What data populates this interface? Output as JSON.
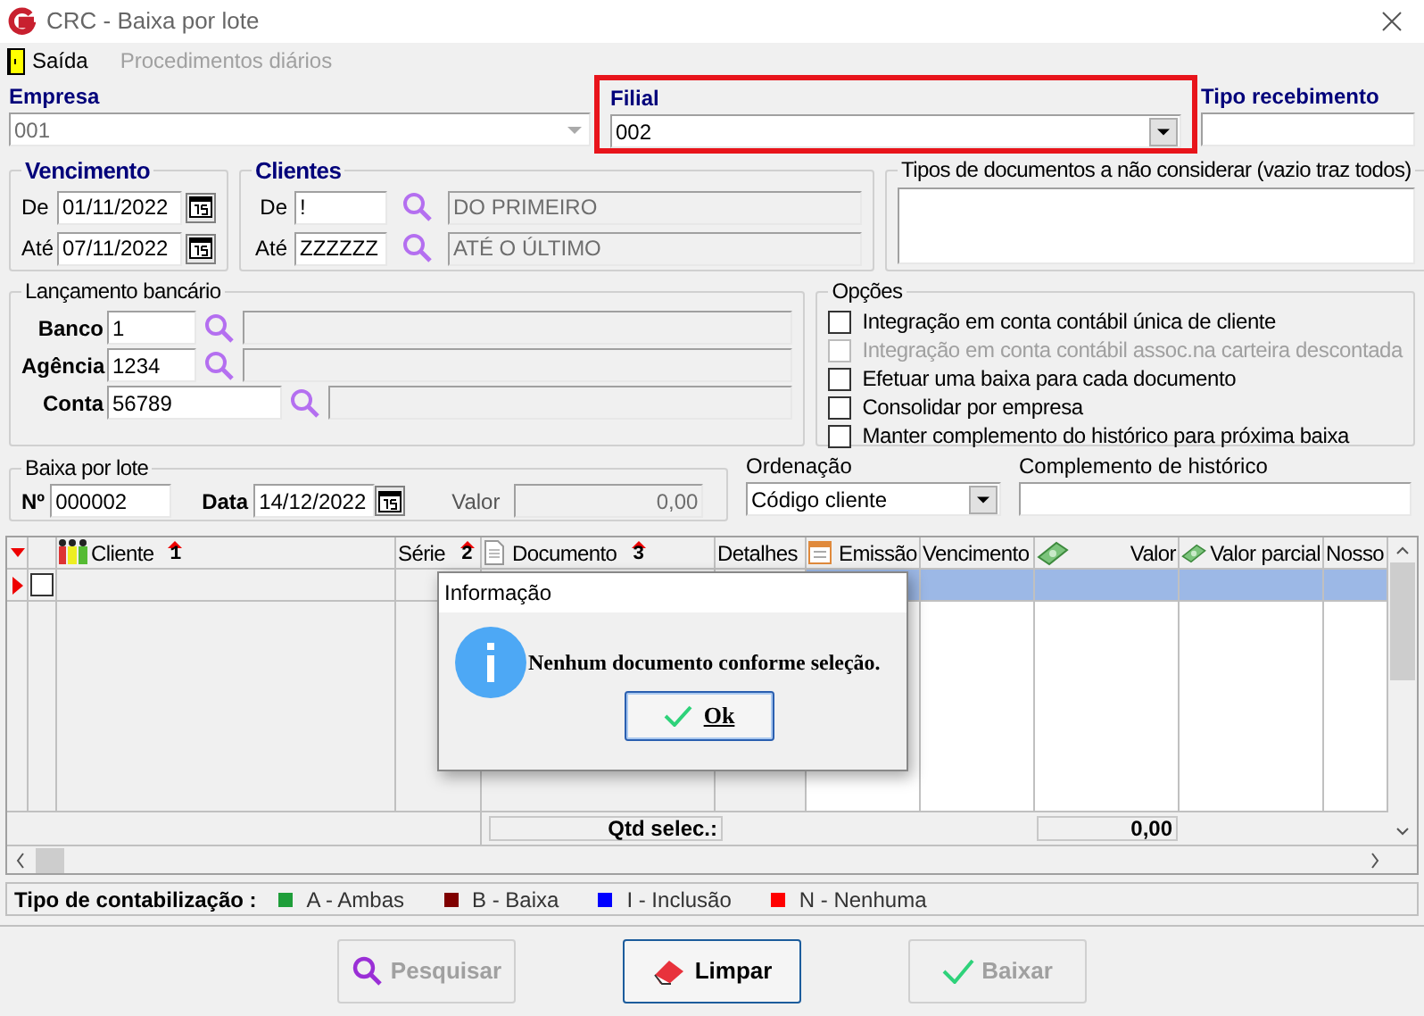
{
  "window": {
    "title": "CRC - Baixa por lote"
  },
  "menu": [
    {
      "label": "Saída",
      "disabled": false
    },
    {
      "label": "Procedimentos diários",
      "disabled": true
    }
  ],
  "empresa": {
    "label": "Empresa",
    "value": "001"
  },
  "filial": {
    "label": "Filial",
    "value": "002",
    "highlighted": true
  },
  "tipo_recebimento": {
    "label": "Tipo recebimento"
  },
  "vencimento": {
    "title": "Vencimento",
    "from_label": "De",
    "from": "01/11/2022",
    "to_label": "Até",
    "to": "07/11/2022"
  },
  "clientes": {
    "title": "Clientes",
    "from_label": "De",
    "from": "!",
    "from_name": "DO PRIMEIRO",
    "to_label": "Até",
    "to": "ZZZZZZ",
    "to_name": "ATÉ O ÚLTIMO"
  },
  "tipos_documentos": {
    "title": "Tipos de documentos a não considerar (vazio traz todos)"
  },
  "lancamento": {
    "title": "Lançamento bancário",
    "fields": [
      {
        "label": "Banco",
        "value": "1"
      },
      {
        "label": "Agência",
        "value": "1234"
      },
      {
        "label": "Conta",
        "value": "56789"
      }
    ]
  },
  "opcoes": {
    "title": "Opções",
    "items": [
      {
        "label": "Integração em conta contábil única de cliente",
        "checked": false,
        "disabled": false
      },
      {
        "label": "Integração em conta contábil assoc.na carteira descontada",
        "checked": false,
        "disabled": true
      },
      {
        "label": "Efetuar uma baixa para cada documento",
        "checked": false,
        "disabled": false
      },
      {
        "label": "Consolidar por empresa",
        "checked": false,
        "disabled": false
      },
      {
        "label": "Manter complemento do histórico para próxima baixa",
        "checked": false,
        "disabled": false
      }
    ]
  },
  "baixa": {
    "title": "Baixa por lote",
    "numero_label": "Nº",
    "numero": "000002",
    "data_label": "Data",
    "data": "14/12/2022",
    "valor_label": "Valor",
    "valor": "0,00"
  },
  "ordenacao": {
    "label": "Ordenação",
    "value": "Código cliente"
  },
  "complemento": {
    "label": "Complemento de histórico"
  },
  "grid": {
    "columns": [
      {
        "label": "Cliente",
        "sort": "1"
      },
      {
        "label": "Série",
        "sort": "2"
      },
      {
        "label": "Documento",
        "sort": "3"
      },
      {
        "label": "Detalhes"
      },
      {
        "label": "Emissão"
      },
      {
        "label": "Vencimento"
      },
      {
        "label": "Valor"
      },
      {
        "label": "Valor parcial"
      },
      {
        "label": "Nosso"
      }
    ],
    "rows": [
      {
        "selected": true,
        "checked": false
      }
    ],
    "footer_label": "Qtd selec.:",
    "footer_total": "0,00"
  },
  "legend": {
    "title": "Tipo de contabilização :",
    "items": [
      {
        "label": "A - Ambas",
        "color": "#1f9e3a"
      },
      {
        "label": "B - Baixa",
        "color": "#7f0000"
      },
      {
        "label": "I - Inclusão",
        "color": "#0000ff"
      },
      {
        "label": "N - Nenhuma",
        "color": "#ff0000"
      }
    ]
  },
  "buttons": [
    {
      "label": "Pesquisar",
      "disabled": true
    },
    {
      "label": "Limpar",
      "disabled": false
    },
    {
      "label": "Baixar",
      "disabled": true
    }
  ],
  "dialog": {
    "title": "Informação",
    "message": "Nenhum documento conforme seleção.",
    "button": "Ok"
  }
}
